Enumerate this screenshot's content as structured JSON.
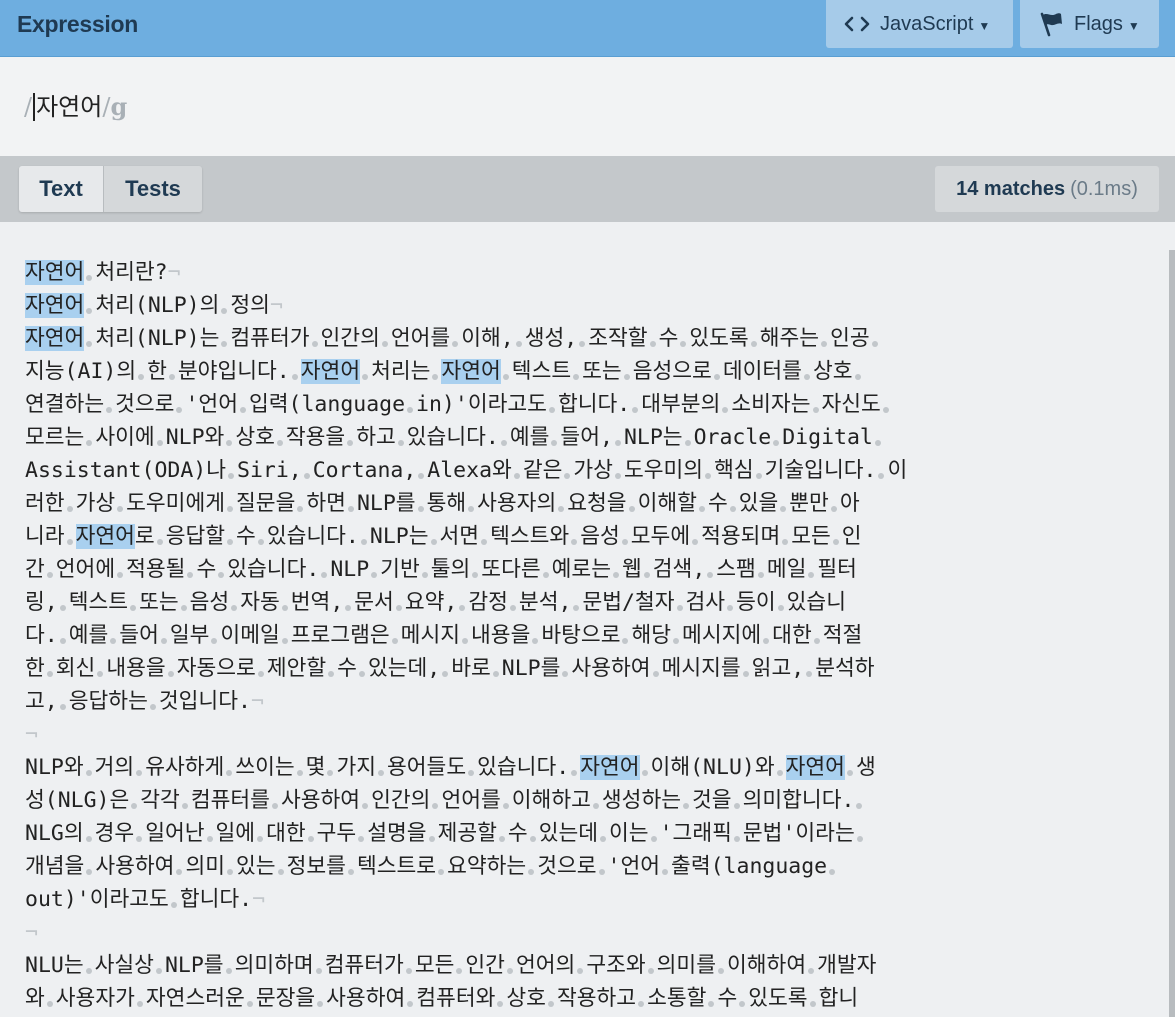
{
  "header": {
    "title": "Expression",
    "flavor_label": "JavaScript",
    "flags_label": "Flags"
  },
  "expression": {
    "open_delimiter": "/",
    "pattern": "자연어",
    "close_delimiter": "/",
    "flags": "g"
  },
  "tabs": [
    {
      "label": "Text",
      "active": true
    },
    {
      "label": "Tests",
      "active": false
    }
  ],
  "status": {
    "matches": "14 matches",
    "time": "(0.1ms)"
  },
  "highlight_color": "#a9d0ef",
  "text_lines": [
    "자연어 처리란?¬",
    "자연어 처리(NLP)의 정의¬",
    "자연어 처리(NLP)는 컴퓨터가 인간의 언어를 이해, 생성, 조작할 수 있도록 해주는 인공 ",
    "지능(AI)의 한 분야입니다. 자연어 처리는 자연어 텍스트 또는 음성으로 데이터를 상호 ",
    "연결하는 것으로 '언어 입력(language in)'이라고도 합니다. 대부분의 소비자는 자신도 ",
    "모르는 사이에 NLP와 상호 작용을 하고 있습니다. 예를 들어, NLP는 Oracle Digital ",
    "Assistant(ODA)나 Siri, Cortana, Alexa와 같은 가상 도우미의 핵심 기술입니다. 이",
    "러한 가상 도우미에게 질문을 하면 NLP를 통해 사용자의 요청을 이해할 수 있을 뿐만 아",
    "니라 자연어로 응답할 수 있습니다. NLP는 서면 텍스트와 음성 모두에 적용되며 모든 인",
    "간 언어에 적용될 수 있습니다. NLP 기반 툴의 또다른 예로는 웹 검색, 스팸 메일 필터",
    "링, 텍스트 또는 음성 자동 번역, 문서 요약, 감정 분석, 문법/철자 검사 등이 있습니",
    "다. 예를 들어 일부 이메일 프로그램은 메시지 내용을 바탕으로 해당 메시지에 대한 적절",
    "한 회신 내용을 자동으로 제안할 수 있는데, 바로 NLP를 사용하여 메시지를 읽고, 분석하",
    "고, 응답하는 것입니다.¬",
    "¬",
    "NLP와 거의 유사하게 쓰이는 몇 가지 용어들도 있습니다. 자연어 이해(NLU)와 자연어 생",
    "성(NLG)은 각각 컴퓨터를 사용하여 인간의 언어를 이해하고 생성하는 것을 의미합니다. ",
    "NLG의 경우 일어난 일에 대한 구두 설명을 제공할 수 있는데 이는 '그래픽 문법'이라는 ",
    "개념을 사용하여 의미 있는 정보를 텍스트로 요약하는 것으로 '언어 출력(language ",
    "out)'이라고도 합니다.¬",
    "¬",
    "NLU는 사실상 NLP를 의미하며 컴퓨터가 모든 인간 언어의 구조와 의미를 이해하여 개발자",
    "와 사용자가 자연스러운 문장을 사용하여 컴퓨터와 상호 작용하고 소통할 수 있도록 합니"
  ]
}
